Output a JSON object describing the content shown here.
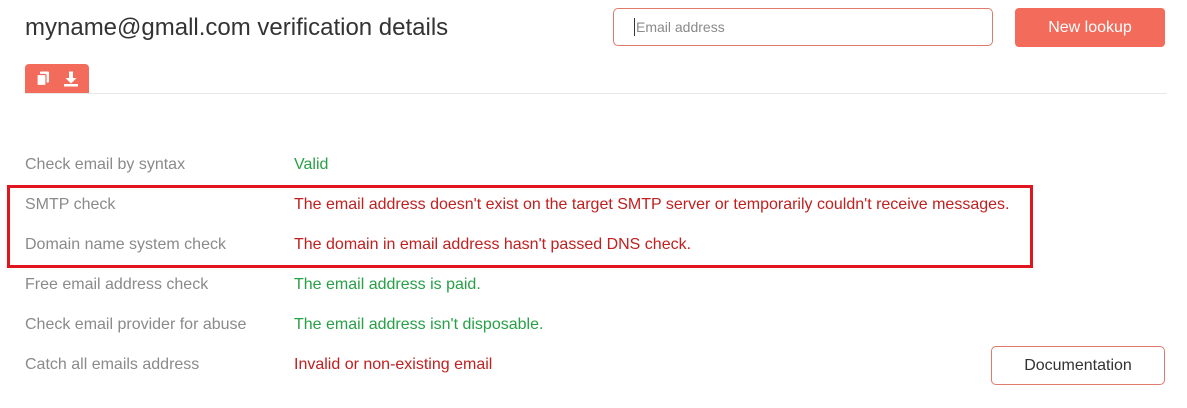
{
  "header": {
    "title": "myname@gmall.com verification details",
    "search_placeholder": "Email address",
    "new_lookup_label": "New lookup"
  },
  "toolbar": {
    "icons": [
      "copy-icon",
      "download-icon"
    ]
  },
  "results": [
    {
      "label": "Check email by syntax",
      "value": "Valid",
      "status": "ok"
    },
    {
      "label": "SMTP check",
      "value": "The email address doesn't exist on the target SMTP server or temporarily couldn't receive messages.",
      "status": "error"
    },
    {
      "label": "Domain name system check",
      "value": "The domain in email address hasn't passed DNS check.",
      "status": "error"
    },
    {
      "label": "Free email address check",
      "value": "The email address is paid.",
      "status": "ok"
    },
    {
      "label": "Check email provider for abuse",
      "value": "The email address isn't disposable.",
      "status": "ok"
    },
    {
      "label": "Catch all emails address",
      "value": "Invalid or non-existing email",
      "status": "error"
    }
  ],
  "documentation_label": "Documentation",
  "colors": {
    "accent": "#f26b5b",
    "ok": "#27a046",
    "error": "#c0201f",
    "highlight": "#e0151d"
  }
}
